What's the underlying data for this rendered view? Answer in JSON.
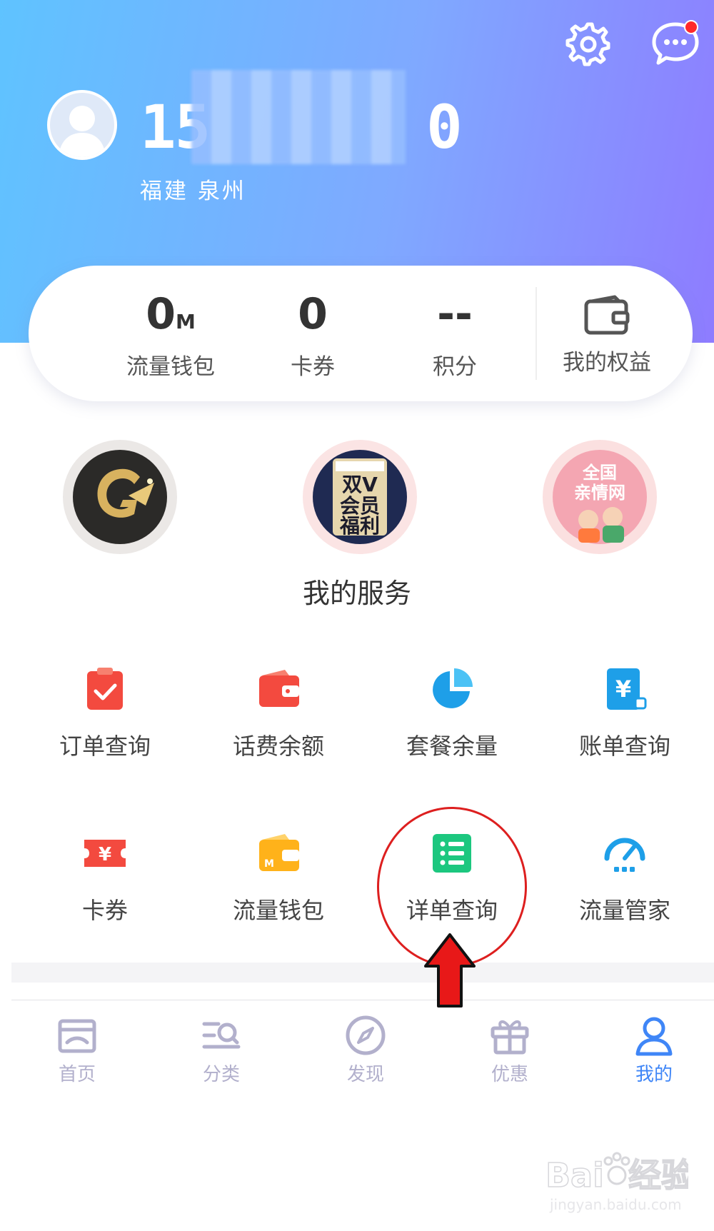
{
  "header": {
    "phone_visible": "15",
    "phone_masked_tail": "0",
    "location": "福建 泉州",
    "icons": {
      "settings": "gear-icon",
      "messages": "chat-bubble-icon"
    },
    "has_unread_dot": true
  },
  "stats": {
    "items": [
      {
        "value": "0",
        "unit": "M",
        "label": "流量钱包"
      },
      {
        "value": "0",
        "unit": "",
        "label": "卡券"
      },
      {
        "value": "--",
        "unit": "",
        "label": "积分"
      }
    ],
    "benefit_label": "我的权益"
  },
  "featured": {
    "items": [
      {
        "icon": "golden-arrow-logo-icon"
      },
      {
        "icon": "double-v-member-badge-icon",
        "lines": [
          "双V",
          "会员",
          "福利"
        ]
      },
      {
        "icon": "family-network-icon",
        "lines": [
          "全国",
          "亲情网"
        ]
      }
    ]
  },
  "services": {
    "title": "我的服务",
    "items": [
      {
        "label": "订单查询",
        "icon": "clipboard-check-icon"
      },
      {
        "label": "话费余额",
        "icon": "wallet-icon"
      },
      {
        "label": "套餐余量",
        "icon": "pie-chart-icon"
      },
      {
        "label": "账单查询",
        "icon": "yuan-bill-icon"
      },
      {
        "label": "卡券",
        "icon": "ticket-icon"
      },
      {
        "label": "流量钱包",
        "icon": "data-wallet-icon"
      },
      {
        "label": "详单查询",
        "icon": "list-icon"
      },
      {
        "label": "流量管家",
        "icon": "speedometer-icon"
      }
    ]
  },
  "tabbar": {
    "items": [
      {
        "label": "首页",
        "icon": "home-icon"
      },
      {
        "label": "分类",
        "icon": "category-icon"
      },
      {
        "label": "发现",
        "icon": "compass-icon"
      },
      {
        "label": "优惠",
        "icon": "gift-icon"
      },
      {
        "label": "我的",
        "icon": "person-icon",
        "active": true
      }
    ]
  },
  "watermark": {
    "brand": "Bai",
    "suffix": "经验",
    "url": "jingyan.baidu.com"
  },
  "colors": {
    "header_gradient": [
      "#5fc3ff",
      "#8e7cff"
    ],
    "tab_active": "#3f86f7",
    "tab_inactive": "#b2b0cc",
    "annotation": "#dd1f1f"
  }
}
